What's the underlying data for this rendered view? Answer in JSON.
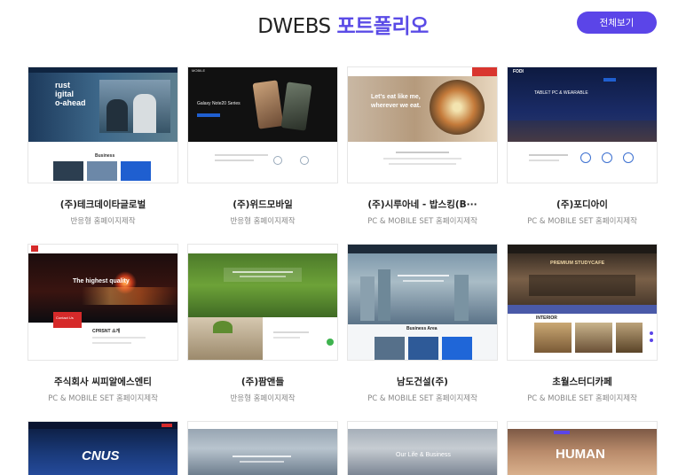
{
  "header": {
    "title_prefix": "DWEBS",
    "title_accent": "포트폴리오",
    "view_all_label": "전체보기"
  },
  "colors": {
    "accent": "#5a4be6",
    "button": "#5b45e8"
  },
  "portfolio": [
    {
      "name": "(주)테크데이타글로벌",
      "desc": "반응형 홈페이지제작",
      "thumb_text": [
        "rust",
        "igital",
        "o-ahead",
        "Business"
      ]
    },
    {
      "name": "(주)위드모바일",
      "desc": "반응형 홈페이지제작",
      "thumb_text": [
        "Galaxy Note20 Series"
      ]
    },
    {
      "name": "(주)시루아네 - 밥스킹(B···",
      "desc": "PC & MOBILE SET 홈페이지제작",
      "thumb_text": [
        "Let's eat like me,",
        "wherever we eat."
      ]
    },
    {
      "name": "(주)포디아이",
      "desc": "PC & MOBILE SET 홈페이지제작",
      "thumb_text": [
        "FODI",
        "TABLET PC & WEARABLE"
      ]
    },
    {
      "name": "주식회사 씨피알에스엔티",
      "desc": "PC & MOBILE SET 홈페이지제작",
      "thumb_text": [
        "The highest quality",
        "Contact Us",
        "CPRSNT 소개"
      ]
    },
    {
      "name": "(주)팜앤들",
      "desc": "반응형 홈페이지제작",
      "thumb_text": []
    },
    {
      "name": "남도건설(주)",
      "desc": "PC & MOBILE SET 홈페이지제작",
      "thumb_text": [
        "Business Area"
      ]
    },
    {
      "name": "초월스터디카페",
      "desc": "PC & MOBILE SET 홈페이지제작",
      "thumb_text": [
        "PREMIUM STUDYCAFE",
        "INTERIOR"
      ]
    },
    {
      "name": "",
      "desc": "",
      "thumb_text": [
        "CNUS"
      ]
    },
    {
      "name": "",
      "desc": "",
      "thumb_text": []
    },
    {
      "name": "",
      "desc": "",
      "thumb_text": [
        "Our Life & Business"
      ]
    },
    {
      "name": "",
      "desc": "",
      "thumb_text": [
        "HUMAN"
      ]
    }
  ]
}
